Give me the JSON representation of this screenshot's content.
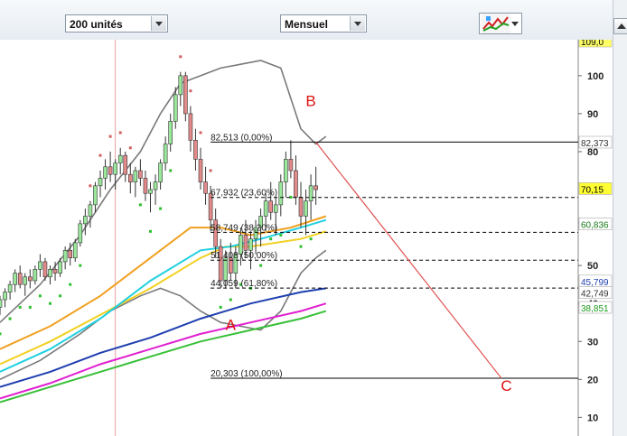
{
  "toolbar": {
    "units_select": "200 unités",
    "period_select": "Mensuel",
    "indicator_button_icon": "chart-indicators-icon"
  },
  "colors": {
    "up_candle": "#9be79b",
    "down_candle": "#e48a8a",
    "fib_line": "#000000",
    "abc_text": "#dd1111",
    "bollinger": "#7a7a7a",
    "sar": "#2fbf2f",
    "sar_down": "#d06060",
    "ma_blue": "#1f3fb0",
    "ma_magenta": "#e020d0",
    "ma_green": "#38c038",
    "ma_orange": "#f0a020",
    "ma_yellow": "#f2d020",
    "ma_cyan": "#20d0e0"
  },
  "chart_data": {
    "type": "candlestick",
    "period": "Mensuel",
    "ylim": [
      7,
      109
    ],
    "y_ticks": [
      {
        "value": 100,
        "label": "100"
      },
      {
        "value": 90,
        "label": "90"
      },
      {
        "value": 80,
        "label": "80"
      },
      {
        "value": 50,
        "label": "50"
      },
      {
        "value": 40,
        "label": "40"
      },
      {
        "value": 30,
        "label": "30"
      },
      {
        "value": 20,
        "label": "20"
      },
      {
        "value": 10,
        "label": "10"
      }
    ],
    "price_tags": [
      {
        "value": 109.0,
        "label": "109,0",
        "bg": "#ffff66",
        "fg": "#000000"
      },
      {
        "value": 82.373,
        "label": "82,373",
        "bg": "#ffffff",
        "fg": "#333333"
      },
      {
        "value": 70.15,
        "label": "70,15",
        "bg": "#ffff33",
        "fg": "#000000"
      },
      {
        "value": 60.836,
        "label": "60,836",
        "bg": "#ffffff",
        "fg": "#1a7a1a"
      },
      {
        "value": 45.799,
        "label": "45,799",
        "bg": "#ffffff",
        "fg": "#1f3fb0"
      },
      {
        "value": 42.749,
        "label": "42,749",
        "bg": "#ffffff",
        "fg": "#333333"
      },
      {
        "value": 38.851,
        "label": "38,851",
        "bg": "#ffffff",
        "fg": "#1a9a1a"
      }
    ],
    "fibonacci": [
      {
        "value": 82.513,
        "label": "82,513 (0,00%)",
        "style": "solid"
      },
      {
        "value": 67.932,
        "label": "67,932 (23,60%)",
        "style": "dashed"
      },
      {
        "value": 58.749,
        "label": "58,749 (38,20%)",
        "style": "dashed"
      },
      {
        "value": 51.408,
        "label": "51,408 (50,00%)",
        "style": "dashed"
      },
      {
        "value": 44.059,
        "label": "44,059 (61,80%)",
        "style": "dashed"
      },
      {
        "value": 20.303,
        "label": "20,303 (100,00%)",
        "style": "solid"
      }
    ],
    "wave_labels": [
      {
        "text": "A",
        "x": 46,
        "y": 33
      },
      {
        "text": "B",
        "x": 62,
        "y": 92
      },
      {
        "text": "C",
        "x": 101,
        "y": 17
      }
    ],
    "projection_line": {
      "from": [
        63,
        82.5
      ],
      "to": [
        100,
        20.3
      ]
    },
    "vertical_marker_x": 23,
    "candles": [
      [
        0,
        39,
        42,
        37,
        41
      ],
      [
        1,
        41,
        44,
        39,
        43
      ],
      [
        2,
        43,
        46,
        41,
        45
      ],
      [
        3,
        45,
        49,
        43,
        48
      ],
      [
        4,
        48,
        50,
        44,
        45
      ],
      [
        5,
        45,
        48,
        42,
        47
      ],
      [
        6,
        47,
        49,
        44,
        46
      ],
      [
        7,
        46,
        50,
        45,
        49
      ],
      [
        8,
        49,
        53,
        47,
        51
      ],
      [
        9,
        51,
        52,
        46,
        47
      ],
      [
        10,
        47,
        50,
        45,
        49
      ],
      [
        11,
        49,
        51,
        46,
        48
      ],
      [
        12,
        48,
        52,
        47,
        51
      ],
      [
        13,
        51,
        55,
        49,
        54
      ],
      [
        14,
        54,
        56,
        50,
        52
      ],
      [
        15,
        52,
        57,
        51,
        56
      ],
      [
        16,
        56,
        62,
        55,
        61
      ],
      [
        17,
        61,
        65,
        58,
        63
      ],
      [
        18,
        63,
        67,
        60,
        66
      ],
      [
        19,
        66,
        72,
        64,
        71
      ],
      [
        20,
        71,
        75,
        68,
        73
      ],
      [
        21,
        73,
        78,
        70,
        76
      ],
      [
        22,
        76,
        80,
        72,
        74
      ],
      [
        23,
        74,
        78,
        70,
        77
      ],
      [
        24,
        77,
        81,
        74,
        79
      ],
      [
        25,
        79,
        80,
        72,
        74
      ],
      [
        26,
        74,
        77,
        69,
        72
      ],
      [
        27,
        72,
        76,
        68,
        75
      ],
      [
        28,
        75,
        78,
        71,
        73
      ],
      [
        29,
        73,
        75,
        67,
        69
      ],
      [
        30,
        69,
        72,
        64,
        70
      ],
      [
        31,
        70,
        74,
        66,
        72
      ],
      [
        32,
        72,
        78,
        70,
        77
      ],
      [
        33,
        77,
        84,
        75,
        82
      ],
      [
        34,
        82,
        90,
        80,
        88
      ],
      [
        35,
        88,
        97,
        86,
        95
      ],
      [
        36,
        95,
        101,
        92,
        100
      ],
      [
        37,
        100,
        101,
        88,
        90
      ],
      [
        38,
        90,
        92,
        80,
        83
      ],
      [
        39,
        83,
        86,
        75,
        78
      ],
      [
        40,
        78,
        81,
        70,
        72
      ],
      [
        41,
        72,
        76,
        66,
        69
      ],
      [
        42,
        69,
        71,
        59,
        62
      ],
      [
        43,
        62,
        65,
        52,
        55
      ],
      [
        44,
        55,
        57,
        44,
        46
      ],
      [
        45,
        46,
        54,
        44,
        52
      ],
      [
        46,
        52,
        56,
        46,
        48
      ],
      [
        47,
        48,
        55,
        44,
        53
      ],
      [
        48,
        53,
        60,
        50,
        58
      ],
      [
        49,
        58,
        62,
        52,
        54
      ],
      [
        50,
        54,
        59,
        49,
        57
      ],
      [
        51,
        57,
        62,
        53,
        60
      ],
      [
        52,
        60,
        65,
        55,
        63
      ],
      [
        53,
        63,
        69,
        59,
        67
      ],
      [
        54,
        67,
        72,
        62,
        64
      ],
      [
        55,
        64,
        68,
        58,
        66
      ],
      [
        56,
        66,
        74,
        63,
        72
      ],
      [
        57,
        72,
        80,
        68,
        78
      ],
      [
        58,
        78,
        83,
        73,
        75
      ],
      [
        59,
        75,
        79,
        66,
        68
      ],
      [
        60,
        68,
        72,
        60,
        63
      ],
      [
        61,
        63,
        70,
        58,
        67
      ],
      [
        62,
        67,
        74,
        62,
        71
      ],
      [
        63,
        71,
        76,
        66,
        70
      ]
    ],
    "moving_averages": [
      {
        "color": "#1f3fb0",
        "values": [
          [
            0,
            18
          ],
          [
            10,
            22
          ],
          [
            20,
            27
          ],
          [
            30,
            31
          ],
          [
            40,
            36
          ],
          [
            50,
            40
          ],
          [
            60,
            43
          ],
          [
            65,
            44
          ]
        ]
      },
      {
        "color": "#e020d0",
        "values": [
          [
            0,
            15
          ],
          [
            10,
            19
          ],
          [
            20,
            24
          ],
          [
            30,
            28
          ],
          [
            40,
            32
          ],
          [
            50,
            35
          ],
          [
            60,
            38
          ],
          [
            65,
            40
          ]
        ]
      },
      {
        "color": "#38c038",
        "values": [
          [
            0,
            14
          ],
          [
            10,
            18
          ],
          [
            20,
            22
          ],
          [
            30,
            26
          ],
          [
            40,
            30
          ],
          [
            50,
            33
          ],
          [
            60,
            36
          ],
          [
            65,
            38
          ]
        ]
      },
      {
        "color": "#f2d020",
        "values": [
          [
            0,
            24
          ],
          [
            10,
            30
          ],
          [
            20,
            37
          ],
          [
            30,
            44
          ],
          [
            40,
            52
          ],
          [
            45,
            55
          ],
          [
            50,
            55
          ],
          [
            60,
            57
          ],
          [
            65,
            59
          ]
        ]
      },
      {
        "color": "#f0a020",
        "values": [
          [
            0,
            28
          ],
          [
            10,
            34
          ],
          [
            20,
            42
          ],
          [
            30,
            52
          ],
          [
            38,
            60
          ],
          [
            44,
            60
          ],
          [
            50,
            58
          ],
          [
            58,
            60
          ],
          [
            65,
            63
          ]
        ]
      },
      {
        "color": "#20d0e0",
        "values": [
          [
            0,
            22
          ],
          [
            10,
            28
          ],
          [
            20,
            36
          ],
          [
            30,
            46
          ],
          [
            40,
            54
          ],
          [
            46,
            55
          ],
          [
            52,
            57
          ],
          [
            60,
            60
          ],
          [
            65,
            62
          ]
        ]
      }
    ],
    "bollinger": [
      {
        "values": [
          [
            0,
            35
          ],
          [
            8,
            45
          ],
          [
            16,
            58
          ],
          [
            22,
            70
          ],
          [
            28,
            80
          ],
          [
            32,
            90
          ],
          [
            36,
            98
          ],
          [
            40,
            100
          ],
          [
            44,
            102
          ],
          [
            48,
            103
          ],
          [
            52,
            104
          ],
          [
            56,
            102
          ],
          [
            60,
            86
          ],
          [
            63,
            82
          ],
          [
            65,
            84
          ]
        ]
      },
      {
        "values": [
          [
            0,
            20
          ],
          [
            8,
            25
          ],
          [
            16,
            32
          ],
          [
            22,
            38
          ],
          [
            28,
            42
          ],
          [
            32,
            44
          ],
          [
            36,
            42
          ],
          [
            40,
            38
          ],
          [
            44,
            35
          ],
          [
            48,
            34
          ],
          [
            52,
            33
          ],
          [
            56,
            38
          ],
          [
            60,
            48
          ],
          [
            63,
            52
          ],
          [
            65,
            54
          ]
        ]
      }
    ]
  }
}
